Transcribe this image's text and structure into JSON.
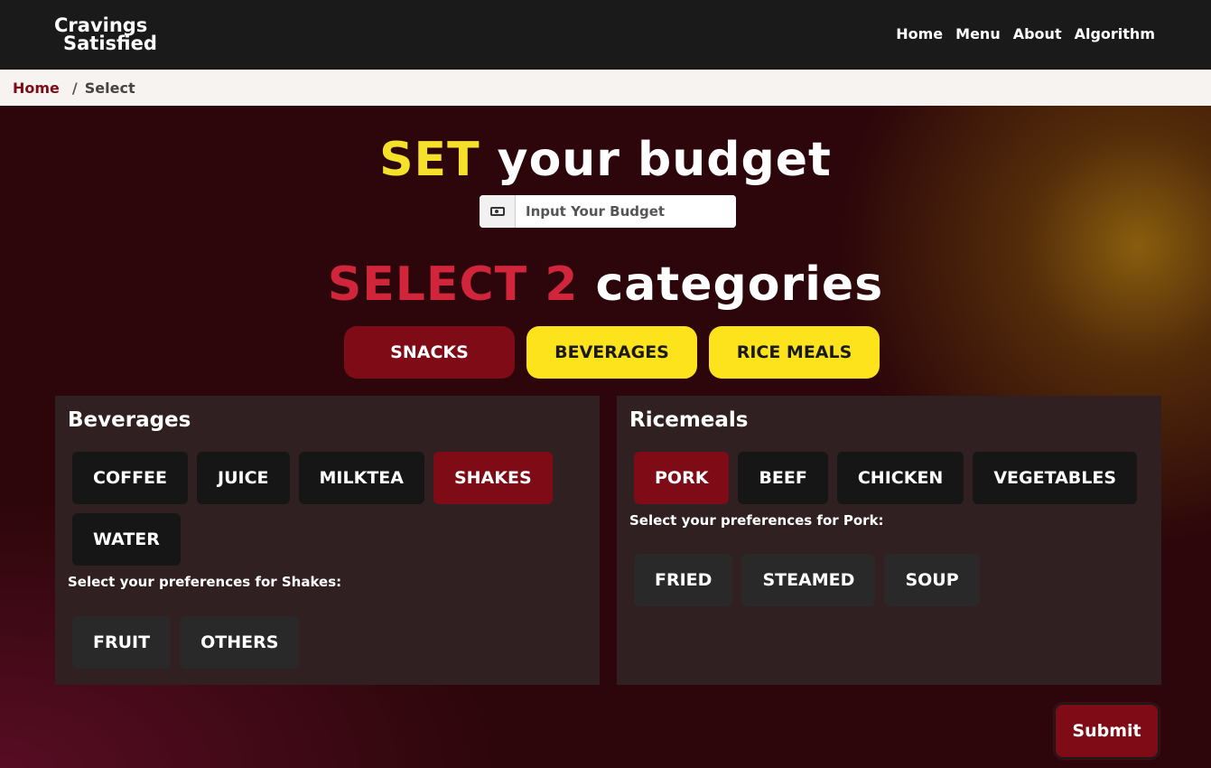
{
  "header": {
    "logo_line1": "Cravings",
    "logo_line2": "Satisfied",
    "nav": [
      "Home",
      "Menu",
      "About",
      "Algorithm"
    ]
  },
  "breadcrumb": {
    "home": "Home",
    "separator": "/",
    "current": "Select"
  },
  "budget": {
    "title_highlight": "SET",
    "title_rest": " your budget",
    "icon": "money-bill-icon",
    "placeholder": "Input Your Budget",
    "value": ""
  },
  "categories": {
    "title_highlight": "SELECT 2",
    "title_rest": " categories",
    "buttons": [
      {
        "label": "SNACKS",
        "state": "active"
      },
      {
        "label": "BEVERAGES",
        "state": "selected"
      },
      {
        "label": "RICE MEALS",
        "state": "selected"
      }
    ]
  },
  "panels": {
    "beverages": {
      "title": "Beverages",
      "options": [
        "COFFEE",
        "JUICE",
        "MILKTEA",
        "SHAKES",
        "WATER"
      ],
      "selected": "SHAKES",
      "pref_label": "Select your preferences for Shakes:",
      "prefs": [
        "FRUIT",
        "OTHERS"
      ]
    },
    "ricemeals": {
      "title": "Ricemeals",
      "options": [
        "PORK",
        "BEEF",
        "CHICKEN",
        "VEGETABLES"
      ],
      "selected": "PORK",
      "pref_label": "Select your preferences for Pork:",
      "prefs": [
        "FRIED",
        "STEAMED",
        "SOUP"
      ]
    }
  },
  "submit_label": "Submit",
  "colors": {
    "accent_red": "#7e0b16",
    "accent_yellow": "#fde31c",
    "title_yellow": "#f5e02a",
    "title_red": "#d0253a"
  }
}
